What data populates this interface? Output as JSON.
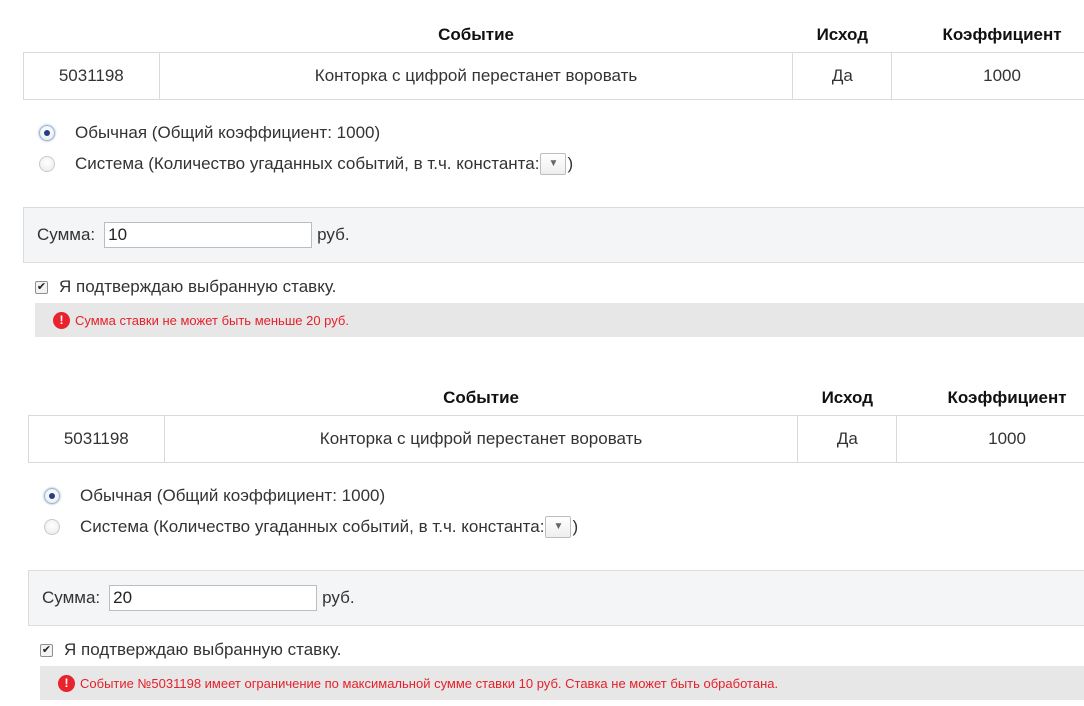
{
  "forms": [
    {
      "table": {
        "headers": {
          "event": "Событие",
          "outcome": "Исход",
          "coefficient": "Коэффициент"
        },
        "row": {
          "id": "5031198",
          "event": "Конторка с цифрой перестанет воровать",
          "outcome": "Да",
          "coefficient": "1000"
        }
      },
      "bet_type": {
        "ordinary_label": "Обычная (Общий коэффициент: 1000)",
        "ordinary_checked": true,
        "system_label": "Система (Количество угаданных событий, в т.ч. константа:",
        "system_label_end": ")",
        "system_select_icon": "▼"
      },
      "sum": {
        "label": "Сумма:",
        "value": "10",
        "unit": "руб."
      },
      "confirm": {
        "label": "Я подтверждаю выбранную ставку.",
        "checked": true
      },
      "error": {
        "icon": "!",
        "message": "Сумма ставки не может быть меньше 20 руб."
      }
    },
    {
      "table": {
        "headers": {
          "event": "Событие",
          "outcome": "Исход",
          "coefficient": "Коэффициент"
        },
        "row": {
          "id": "5031198",
          "event": "Конторка с цифрой перестанет воровать",
          "outcome": "Да",
          "coefficient": "1000"
        }
      },
      "bet_type": {
        "ordinary_label": "Обычная (Общий коэффициент: 1000)",
        "ordinary_checked": true,
        "system_label": "Система (Количество угаданных событий, в т.ч. константа:",
        "system_label_end": ")",
        "system_select_icon": "▼"
      },
      "sum": {
        "label": "Сумма:",
        "value": "20",
        "unit": "руб."
      },
      "confirm": {
        "label": "Я подтверждаю выбранную ставку.",
        "checked": true
      },
      "error": {
        "icon": "!",
        "message": "Событие №5031198 имеет ограничение по максимальной сумме ставки 10 руб. Ставка не может быть обработана."
      }
    }
  ],
  "colors": {
    "error_text": "#e5212b",
    "error_bg": "#e7e7e7",
    "sum_bar_bg": "#f4f5f6",
    "radio_selected": "#1f3f8f"
  }
}
